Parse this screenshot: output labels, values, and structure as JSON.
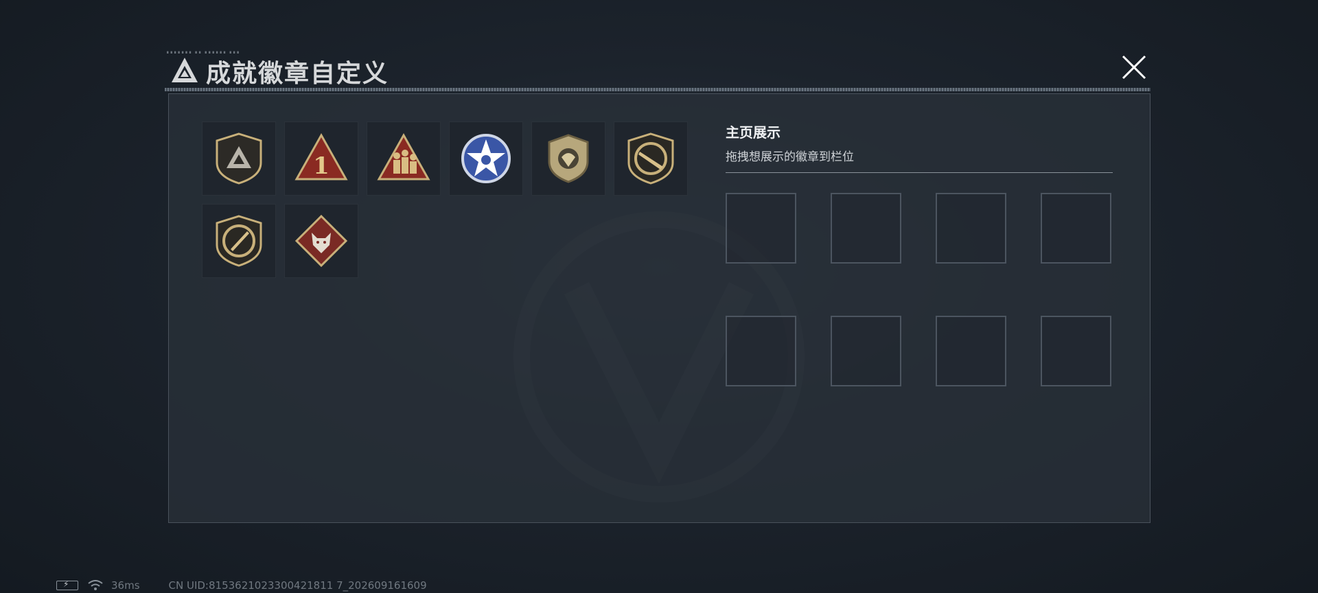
{
  "window": {
    "title": "成就徽章自定义",
    "close_icon": "close-icon"
  },
  "badges": [
    {
      "icon": "shield-triangle-badge-icon"
    },
    {
      "icon": "triangle-number-one-badge-icon"
    },
    {
      "icon": "triangle-soldiers-badge-icon"
    },
    {
      "icon": "blue-star-badge-icon"
    },
    {
      "icon": "shield-parachute-badge-icon"
    },
    {
      "icon": "shield-rifle-badge-icon"
    },
    {
      "icon": "shield-knife-badge-icon"
    },
    {
      "icon": "diamond-wolf-badge-icon"
    }
  ],
  "showcase": {
    "title": "主页展示",
    "subtitle": "拖拽想展示的徽章到栏位",
    "slot_count": 8
  },
  "status": {
    "ping": "36ms",
    "uid": "CN UID:8153621023300421811 7_202609161609"
  },
  "colors": {
    "accent_gold": "#c8b07a",
    "badge_red": "#8a2a22",
    "badge_blue": "#3a56a6"
  }
}
